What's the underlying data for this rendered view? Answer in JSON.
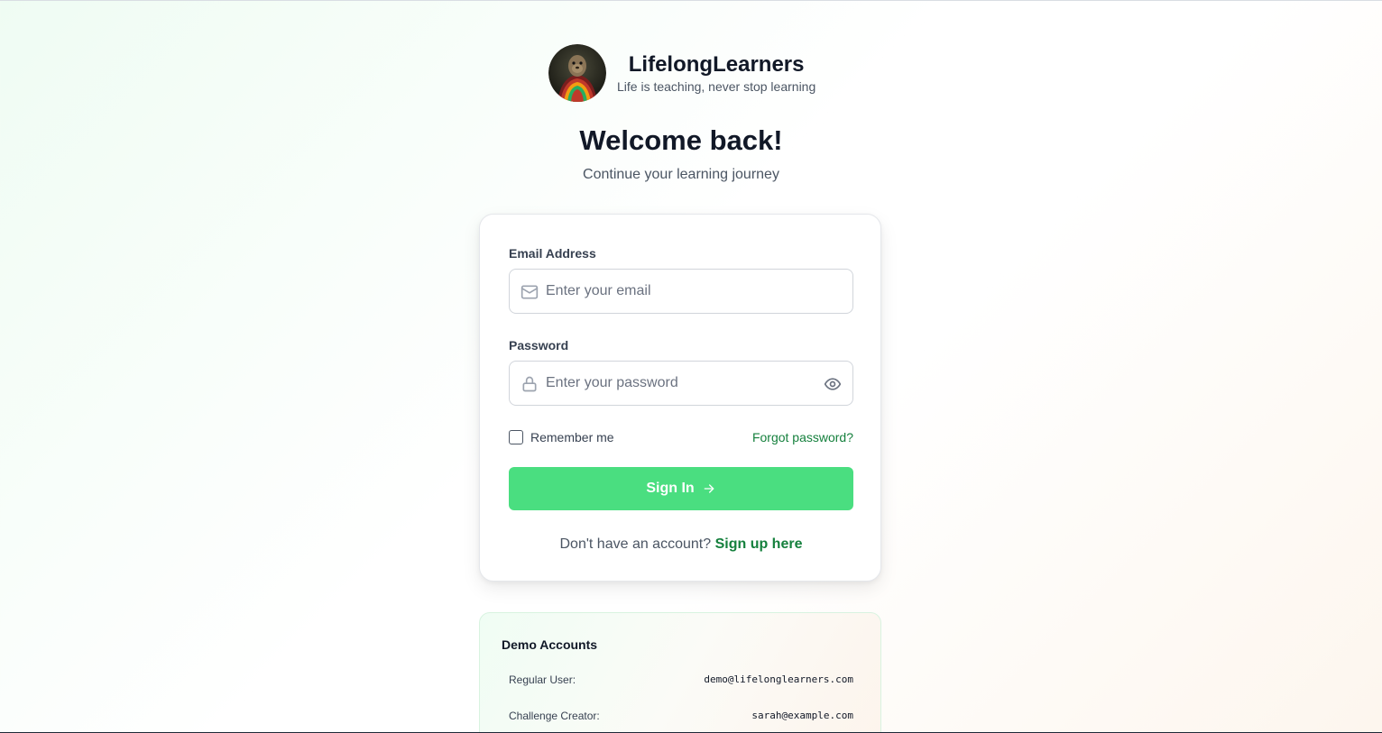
{
  "brand": {
    "name": "LifelongLearners",
    "tagline": "Life is teaching, never stop learning"
  },
  "heading": {
    "title": "Welcome back!",
    "subtitle": "Continue your learning journey"
  },
  "form": {
    "email_label": "Email Address",
    "email_placeholder": "Enter your email",
    "email_value": "",
    "password_label": "Password",
    "password_placeholder": "Enter your password",
    "password_value": "",
    "remember_label": "Remember me",
    "remember_checked": false,
    "forgot_label": "Forgot password?",
    "submit_label": "Sign In",
    "signup_prompt": "Don't have an account?",
    "signup_link": "Sign up here"
  },
  "demo": {
    "title": "Demo Accounts",
    "accounts": [
      {
        "role": "Regular User:",
        "email": "demo@lifelonglearners.com"
      },
      {
        "role": "Challenge Creator:",
        "email": "sarah@example.com"
      }
    ]
  },
  "colors": {
    "accent": "#4ade80",
    "link": "#15803d",
    "text": "#111827"
  },
  "icons": {
    "email": "mail-icon",
    "password": "lock-icon",
    "toggle": "eye-icon",
    "submit": "arrow-right-icon"
  }
}
